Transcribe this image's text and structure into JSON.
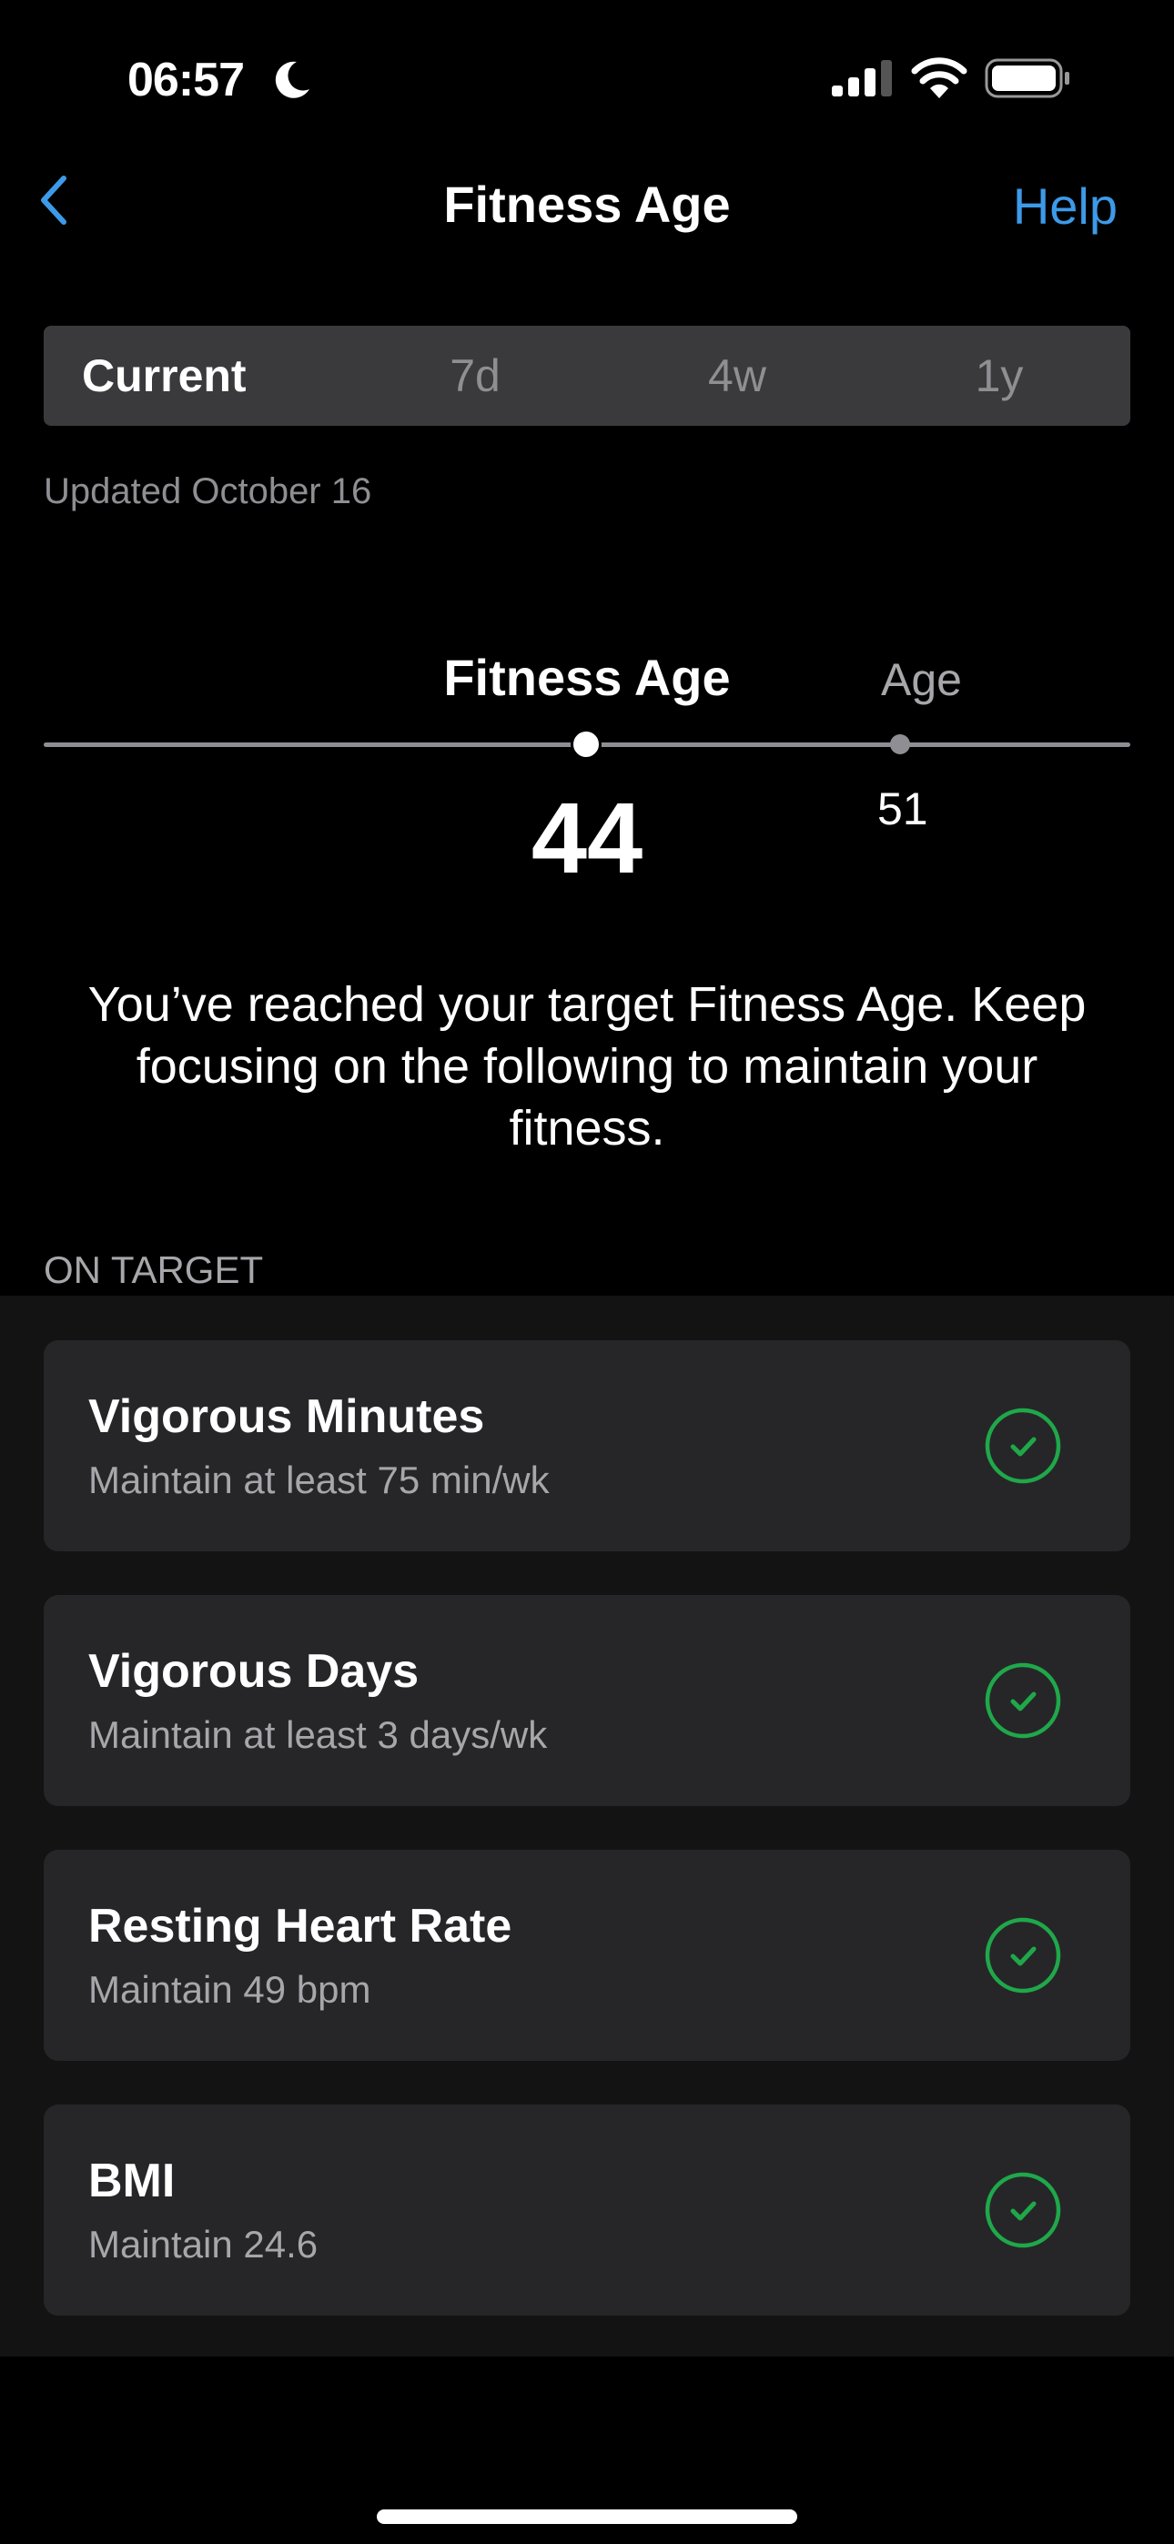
{
  "status_bar": {
    "time": "06:57"
  },
  "nav": {
    "title": "Fitness Age",
    "help": "Help"
  },
  "segments": [
    "Current",
    "7d",
    "4w",
    "1y"
  ],
  "updated": "Updated October 16",
  "gauge": {
    "fitness_age_label": "Fitness Age",
    "fitness_age_value": "44",
    "age_label": "Age",
    "age_value": "51"
  },
  "message": "You’ve reached your target Fitness Age. Keep focusing on the following to maintain your fitness.",
  "section_header": "ON TARGET",
  "items": [
    {
      "title": "Vigorous Minutes",
      "subtitle": "Maintain at least 75 min/wk"
    },
    {
      "title": "Vigorous Days",
      "subtitle": "Maintain at least 3 days/wk"
    },
    {
      "title": "Resting Heart Rate",
      "subtitle": "Maintain 49 bpm"
    },
    {
      "title": "BMI",
      "subtitle": "Maintain 24.6"
    }
  ],
  "colors": {
    "accent": "#3d9ae8",
    "check": "#1fa84a",
    "card": "#262628"
  }
}
